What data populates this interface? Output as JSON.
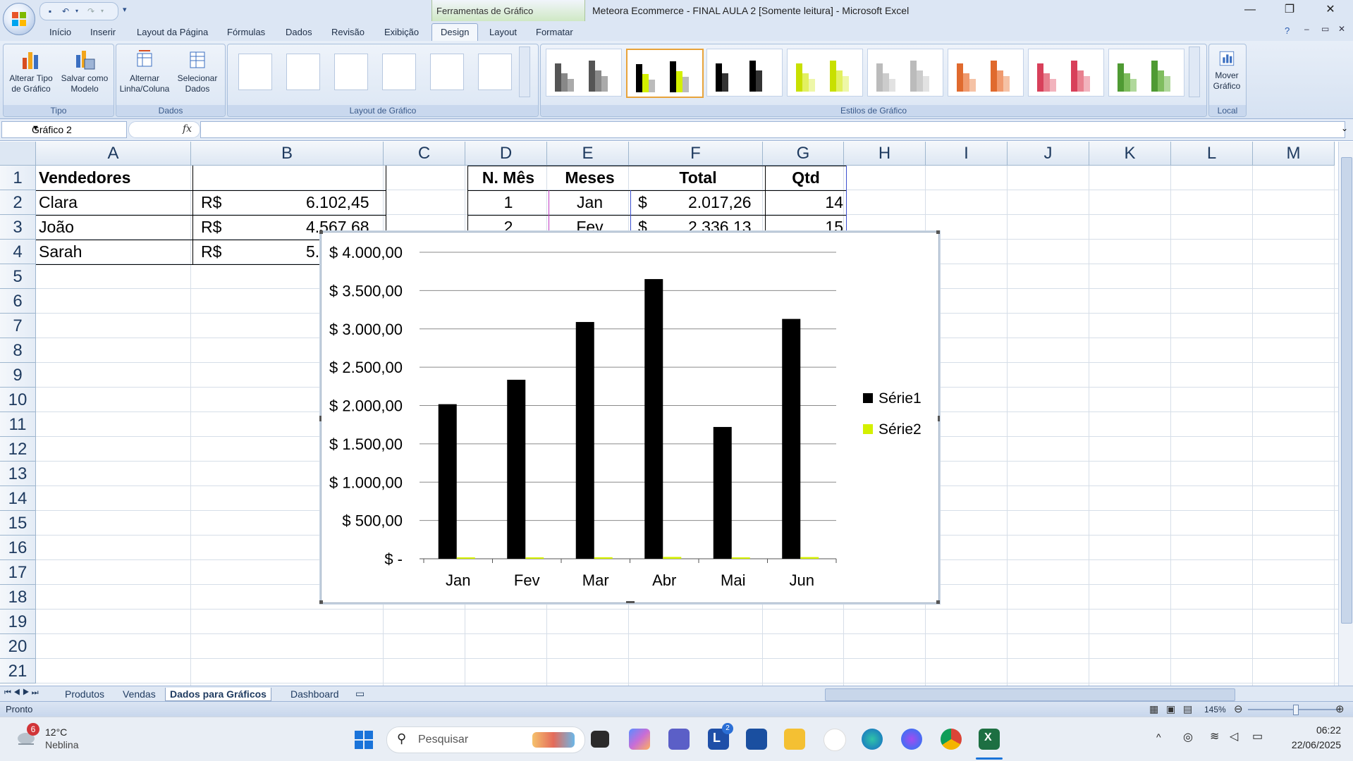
{
  "title_bar": {
    "context_tab": "Ferramentas de Gráfico",
    "window_title": "Meteora Ecommerce - FINAL AULA 2  [Somente leitura] - Microsoft Excel"
  },
  "ribbon_tabs": [
    "Início",
    "Inserir",
    "Layout da Página",
    "Fórmulas",
    "Dados",
    "Revisão",
    "Exibição",
    "Design",
    "Layout",
    "Formatar"
  ],
  "ribbon": {
    "tipo": {
      "label": "Tipo",
      "alterar_tipo_1": "Alterar Tipo",
      "alterar_tipo_2": "de Gráfico",
      "salvar_modelo_1": "Salvar como",
      "salvar_modelo_2": "Modelo"
    },
    "dados": {
      "label": "Dados",
      "alternar_1": "Alternar",
      "alternar_2": "Linha/Coluna",
      "selecionar_1": "Selecionar",
      "selecionar_2": "Dados"
    },
    "layout_grafico": {
      "label": "Layout de Gráfico"
    },
    "estilos": {
      "label": "Estilos de Gráfico"
    },
    "local": {
      "label": "Local",
      "mover_1": "Mover",
      "mover_2": "Gráfico"
    }
  },
  "formula_bar": {
    "name_box": "Gráfico 2",
    "fx": "fx",
    "formula": ""
  },
  "columns": [
    "A",
    "B",
    "C",
    "D",
    "E",
    "F",
    "G",
    "H",
    "I",
    "J",
    "K",
    "L",
    "M"
  ],
  "rows": [
    "1",
    "2",
    "3",
    "4",
    "5",
    "6",
    "7",
    "8",
    "9",
    "10",
    "11",
    "12",
    "13",
    "14",
    "15",
    "16",
    "17",
    "18",
    "19",
    "20",
    "21"
  ],
  "cells": {
    "A1": "Vendedores",
    "A2": "Clara",
    "A3": "João",
    "A4": "Sarah",
    "B2_cur": "R$",
    "B2": "6.102,45",
    "B3_cur": "R$",
    "B3": "4.567,68",
    "B4_cur": "R$",
    "B4": "5.",
    "D1": "N. Mês",
    "E1": "Meses",
    "F1": "Total",
    "G1": "Qtd",
    "D2": "1",
    "E2": "Jan",
    "F2_cur": "$",
    "F2": "2.017,26",
    "G2": "14",
    "D3": "2",
    "E3": "Fev",
    "F3_cur": "$",
    "F3": "2.336,13",
    "G3": "15"
  },
  "chart_data": {
    "type": "bar",
    "categories": [
      "Jan",
      "Fev",
      "Mar",
      "Abr",
      "Mai",
      "Jun"
    ],
    "series": [
      {
        "name": "Série1",
        "values": [
          2017.26,
          2336.13,
          3090,
          3650,
          1720,
          3130
        ],
        "color": "#000000"
      },
      {
        "name": "Série2",
        "values": [
          14,
          15,
          20,
          24,
          12,
          22
        ],
        "color": "#d4f000"
      }
    ],
    "ylim": [
      0,
      4000
    ],
    "yticks": [
      "$ -",
      "$ 500,00",
      "$ 1.000,00",
      "$ 1.500,00",
      "$ 2.000,00",
      "$ 2.500,00",
      "$ 3.000,00",
      "$ 3.500,00",
      "$ 4.000,00"
    ],
    "grid": true,
    "legend": "right"
  },
  "sheet_tabs": [
    "Produtos",
    "Vendas",
    "Dados para Gráficos",
    "Dashboard"
  ],
  "active_sheet": "Dados para Gráficos",
  "status": {
    "left": "Pronto",
    "zoom": "145%"
  },
  "taskbar": {
    "weather_temp": "12°C",
    "weather_desc": "Neblina",
    "weather_badge": "6",
    "search_placeholder": "Pesquisar",
    "time": "06:22",
    "date": "22/06/2025"
  }
}
